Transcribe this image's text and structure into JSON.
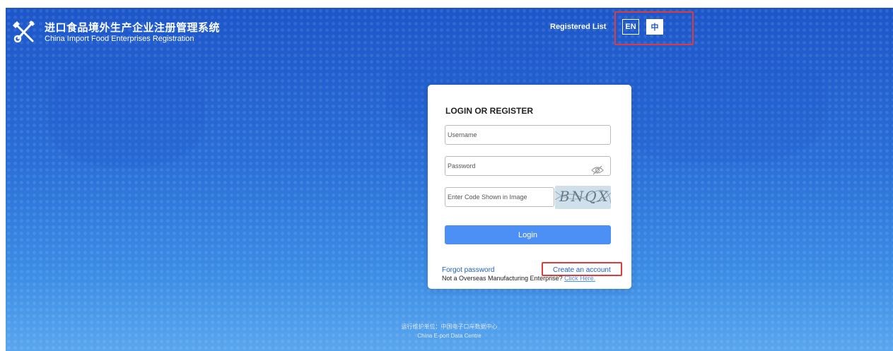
{
  "header": {
    "title_zh": "进口食品境外生产企业注册管理系统",
    "title_en": "China Import Food Enterprises Registration",
    "logo_icon": "tools-cross-icon",
    "registered_list": "Registered List",
    "lang_en": "EN",
    "lang_zh": "中"
  },
  "login": {
    "title": "LOGIN OR REGISTER",
    "username_placeholder": "Username",
    "password_placeholder": "Password",
    "password_icon": "eye-hidden-icon",
    "captcha_placeholder": "Enter Code Shown in Image",
    "captcha_text": "BNQX",
    "login_label": "Login",
    "forgot_label": "Forgot password",
    "create_label": "Create an account",
    "not_overseas_text": "Not a Overseas Manufacturing Enterprise?",
    "click_here": "Click Here."
  },
  "footer": {
    "zh": "运行维护单位：中国电子口岸数据中心",
    "en": "China E-port Data Centre"
  },
  "colors": {
    "background": "#2a6fd8",
    "accent": "#4c8ff5",
    "highlight_border": "#e03a3a"
  }
}
